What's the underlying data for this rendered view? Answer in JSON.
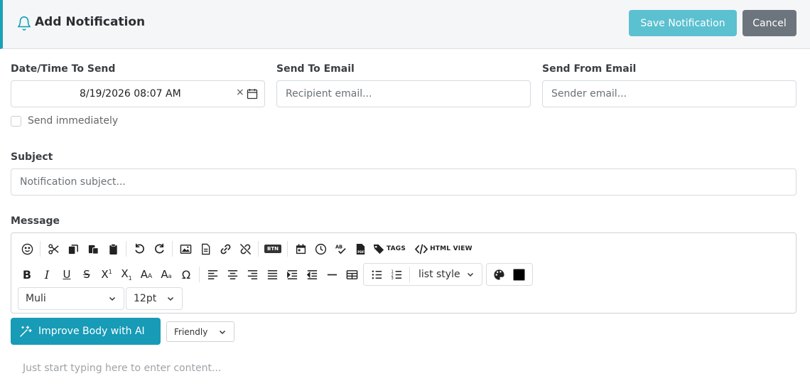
{
  "header": {
    "title": "Add Notification",
    "save_label": "Save Notification",
    "cancel_label": "Cancel"
  },
  "form": {
    "date_label": "Date/Time To Send",
    "date_value": "8/19/2026 08:07 AM",
    "date_clear": "×",
    "to_label": "Send To Email",
    "to_placeholder": "Recipient email...",
    "from_label": "Send From Email",
    "from_placeholder": "Sender email...",
    "immediate_label": "Send immediately",
    "immediate_checked": false,
    "subject_label": "Subject",
    "subject_placeholder": "Notification subject...",
    "message_label": "Message"
  },
  "toolbar": {
    "tags_label": "TAGS",
    "html_view_label": "HTML VIEW",
    "btn_badge": "BTN",
    "list_style_label": "list style",
    "font_value": "Muli",
    "size_value": "12pt",
    "text_color": "#000000"
  },
  "ai": {
    "improve_label": "Improve Body with AI",
    "tone_value": "Friendly"
  },
  "editor": {
    "placeholder": "Just start typing here to enter content..."
  },
  "colors": {
    "accent": "#17a2b8",
    "save_button": "#5bc0d0",
    "cancel_button": "#6c757d",
    "ai_button": "#179bb6"
  }
}
